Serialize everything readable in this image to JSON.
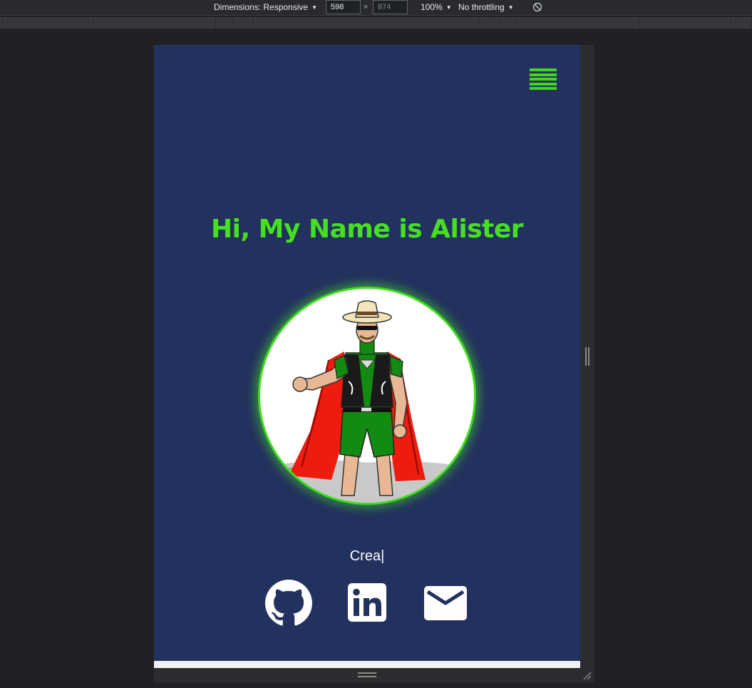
{
  "devtools": {
    "dimensions_label": "Dimensions: Responsive",
    "width_value": "598",
    "height_value": "874",
    "times_sign": "×",
    "zoom_label": "100%",
    "throttle_label": "No throttling",
    "caret": "▼"
  },
  "page": {
    "menu_icon": "hamburger-menu-icon",
    "hero_title": "Hi, My Name is Alister",
    "avatar_icon": "superhero-avatar-image",
    "typed_text": "Crea|",
    "social_links": [
      {
        "icon": "github-icon"
      },
      {
        "icon": "linkedin-icon"
      },
      {
        "icon": "email-icon"
      }
    ]
  },
  "colors": {
    "page_background": "#23315e",
    "accent_green": "#45e022",
    "icon_white": "#ffffff",
    "devtools_background": "#202124"
  }
}
